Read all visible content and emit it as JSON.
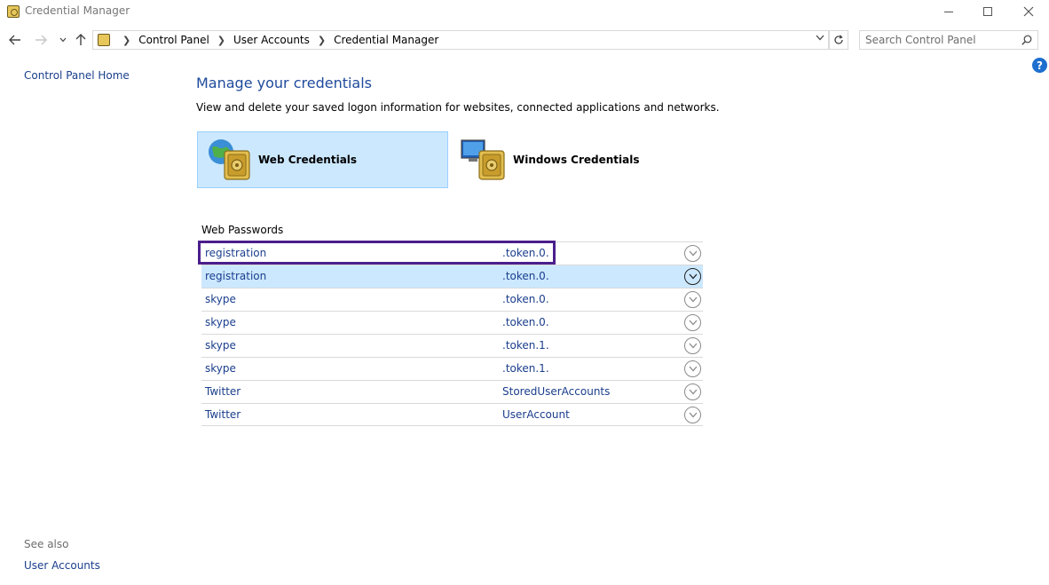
{
  "window": {
    "title": "Credential Manager"
  },
  "address": {
    "crumbs": [
      "Control Panel",
      "User Accounts",
      "Credential Manager"
    ],
    "search_placeholder": "Search Control Panel"
  },
  "left_pane": {
    "home_link": "Control Panel Home",
    "see_also_label": "See also",
    "see_also_links": [
      "User Accounts"
    ]
  },
  "main": {
    "title": "Manage your credentials",
    "description": "View and delete your saved logon information for websites, connected applications and networks.",
    "tiles": [
      {
        "label": "Web Credentials",
        "selected": true
      },
      {
        "label": "Windows Credentials",
        "selected": false
      }
    ],
    "section_label": "Web Passwords",
    "rows": [
      {
        "name": "registration",
        "detail": ".token.0."
      },
      {
        "name": "registration",
        "detail": ".token.0."
      },
      {
        "name": "skype",
        "detail": ".token.0."
      },
      {
        "name": "skype",
        "detail": ".token.0."
      },
      {
        "name": "skype",
        "detail": ".token.1."
      },
      {
        "name": "skype",
        "detail": ".token.1."
      },
      {
        "name": "Twitter",
        "detail": "StoredUserAccounts"
      },
      {
        "name": "Twitter",
        "detail": "UserAccount"
      }
    ]
  },
  "colors": {
    "link": "#1a3e8c",
    "title_blue": "#1e4a9c",
    "selection": "#cce8ff",
    "highlight_outline": "#4b1f8c"
  }
}
